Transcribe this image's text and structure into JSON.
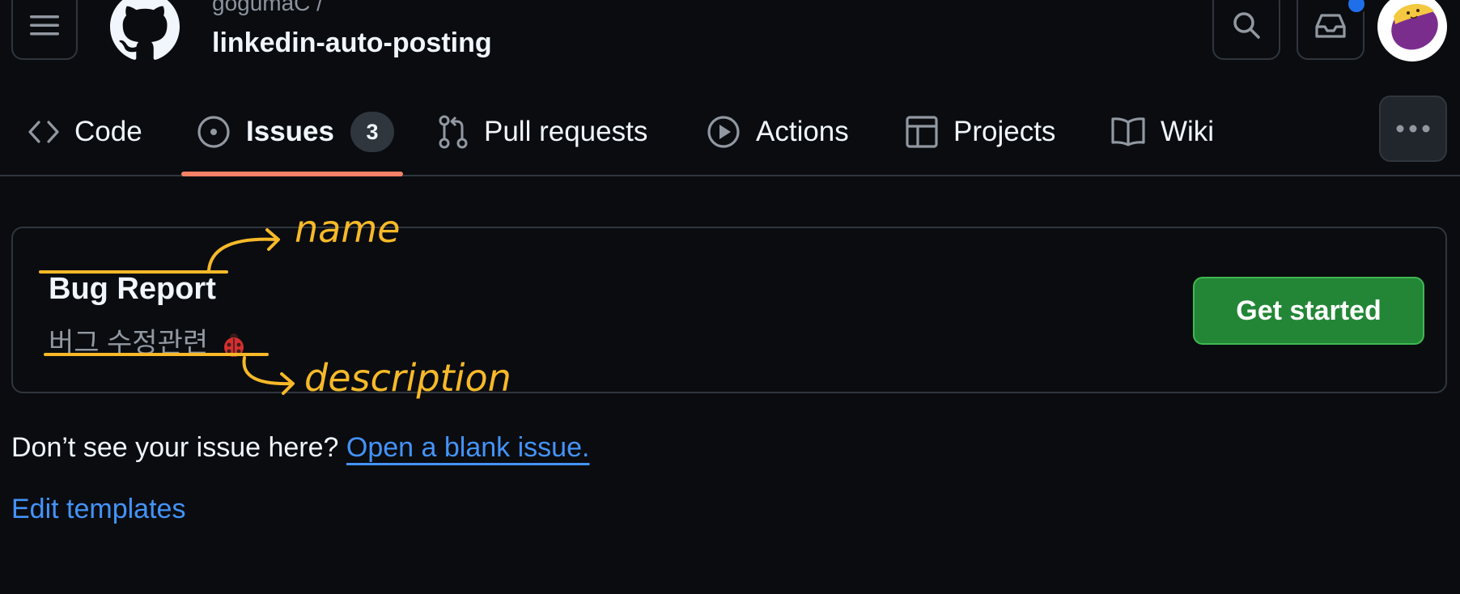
{
  "header": {
    "owner": "gogumaC /",
    "repo": "linkedin-auto-posting"
  },
  "tabs": [
    {
      "label": "Code",
      "icon": "code-icon"
    },
    {
      "label": "Issues",
      "icon": "issue-opened-icon",
      "count": "3",
      "selected": true
    },
    {
      "label": "Pull requests",
      "icon": "git-pull-request-icon"
    },
    {
      "label": "Actions",
      "icon": "play-icon"
    },
    {
      "label": "Projects",
      "icon": "table-icon"
    },
    {
      "label": "Wiki",
      "icon": "book-icon"
    }
  ],
  "template": {
    "name": "Bug Report",
    "description": "버그 수정관련",
    "description_emoji": "ladybug-icon",
    "button": "Get started"
  },
  "annotations": {
    "name": "name",
    "description": "description",
    "color": "#f7b928"
  },
  "footer": {
    "prompt": "Don’t see your issue here? ",
    "blank_issue_link": "Open a blank issue.",
    "edit_templates": "Edit templates"
  },
  "colors": {
    "background": "#0a0c10",
    "accent_underline": "#f78166",
    "link": "#4493f8",
    "primary_button": "#238636",
    "notification": "#1f6feb"
  }
}
